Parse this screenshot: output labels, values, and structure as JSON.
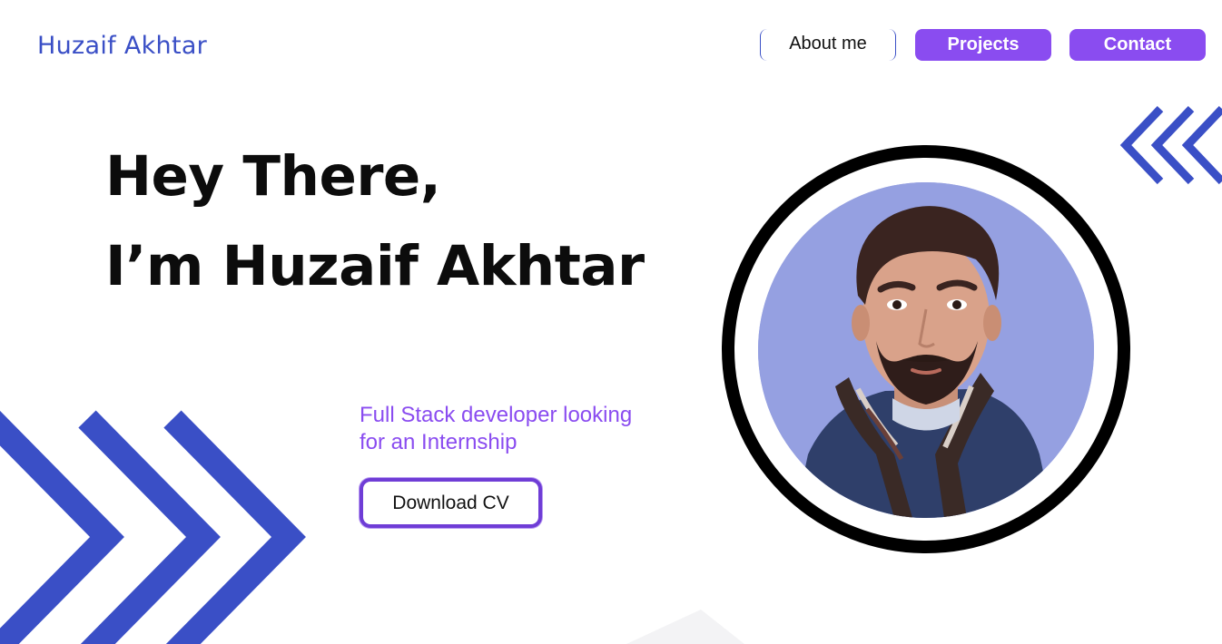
{
  "header": {
    "logo_text": "Huzaif Akhtar",
    "nav": {
      "about": "About me",
      "projects": "Projects",
      "contact": "Contact"
    }
  },
  "hero": {
    "greeting_line1": "Hey There,",
    "greeting_line2": "I’m Huzaif Akhtar",
    "tagline_line1": "Full Stack developer looking",
    "tagline_line2": "for an Internship",
    "cta_label": "Download CV"
  },
  "icons": {
    "portrait": "profile-photo",
    "left_decoration": "chevrons-right-icon",
    "right_decoration": "chevrons-left-icon"
  },
  "colors": {
    "brand_blue": "#3a4fc6",
    "accent_purple": "#8a4cf0",
    "cta_border": "#6f3dd6",
    "portrait_bg": "#95a0e1",
    "text_dark": "#0c0c0c"
  }
}
